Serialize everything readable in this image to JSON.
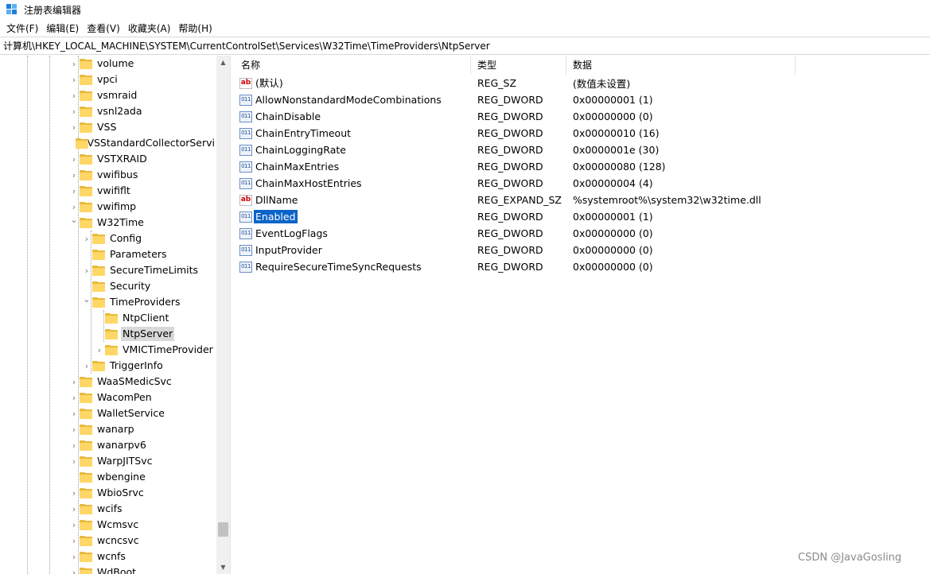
{
  "window": {
    "title": "注册表编辑器",
    "app_icon": "regedit-icon"
  },
  "menu": [
    "文件(F)",
    "编辑(E)",
    "查看(V)",
    "收藏夹(A)",
    "帮助(H)"
  ],
  "address": "计算机\\HKEY_LOCAL_MACHINE\\SYSTEM\\CurrentControlSet\\Services\\W32Time\\TimeProviders\\NtpServer",
  "tree": [
    {
      "label": "volume",
      "depth": 0,
      "expander": "collapsed"
    },
    {
      "label": "vpci",
      "depth": 0,
      "expander": "collapsed"
    },
    {
      "label": "vsmraid",
      "depth": 0,
      "expander": "collapsed"
    },
    {
      "label": "vsnl2ada",
      "depth": 0,
      "expander": "collapsed"
    },
    {
      "label": "VSS",
      "depth": 0,
      "expander": "collapsed"
    },
    {
      "label": "VSStandardCollectorServi",
      "depth": 0,
      "expander": "none"
    },
    {
      "label": "VSTXRAID",
      "depth": 0,
      "expander": "collapsed"
    },
    {
      "label": "vwifibus",
      "depth": 0,
      "expander": "collapsed"
    },
    {
      "label": "vwififlt",
      "depth": 0,
      "expander": "collapsed"
    },
    {
      "label": "vwifimp",
      "depth": 0,
      "expander": "collapsed"
    },
    {
      "label": "W32Time",
      "depth": 0,
      "expander": "expanded"
    },
    {
      "label": "Config",
      "depth": 1,
      "expander": "collapsed"
    },
    {
      "label": "Parameters",
      "depth": 1,
      "expander": "none"
    },
    {
      "label": "SecureTimeLimits",
      "depth": 1,
      "expander": "collapsed"
    },
    {
      "label": "Security",
      "depth": 1,
      "expander": "none"
    },
    {
      "label": "TimeProviders",
      "depth": 1,
      "expander": "expanded"
    },
    {
      "label": "NtpClient",
      "depth": 2,
      "expander": "none"
    },
    {
      "label": "NtpServer",
      "depth": 2,
      "expander": "none",
      "selected": true
    },
    {
      "label": "VMICTimeProvider",
      "depth": 2,
      "expander": "collapsed"
    },
    {
      "label": "TriggerInfo",
      "depth": 1,
      "expander": "collapsed"
    },
    {
      "label": "WaaSMedicSvc",
      "depth": 0,
      "expander": "collapsed"
    },
    {
      "label": "WacomPen",
      "depth": 0,
      "expander": "collapsed"
    },
    {
      "label": "WalletService",
      "depth": 0,
      "expander": "collapsed"
    },
    {
      "label": "wanarp",
      "depth": 0,
      "expander": "collapsed"
    },
    {
      "label": "wanarpv6",
      "depth": 0,
      "expander": "collapsed"
    },
    {
      "label": "WarpJITSvc",
      "depth": 0,
      "expander": "collapsed"
    },
    {
      "label": "wbengine",
      "depth": 0,
      "expander": "none"
    },
    {
      "label": "WbioSrvc",
      "depth": 0,
      "expander": "collapsed"
    },
    {
      "label": "wcifs",
      "depth": 0,
      "expander": "collapsed"
    },
    {
      "label": "Wcmsvc",
      "depth": 0,
      "expander": "collapsed"
    },
    {
      "label": "wcncsvc",
      "depth": 0,
      "expander": "collapsed"
    },
    {
      "label": "wcnfs",
      "depth": 0,
      "expander": "collapsed"
    },
    {
      "label": "WdBoot",
      "depth": 0,
      "expander": "collapsed"
    }
  ],
  "columns": {
    "name": "名称",
    "type": "类型",
    "data": "数据"
  },
  "values": [
    {
      "name": "(默认)",
      "type": "REG_SZ",
      "data": "(数值未设置)",
      "icon": "string-value-icon"
    },
    {
      "name": "AllowNonstandardModeCombinations",
      "type": "REG_DWORD",
      "data": "0x00000001 (1)",
      "icon": "binary-value-icon"
    },
    {
      "name": "ChainDisable",
      "type": "REG_DWORD",
      "data": "0x00000000 (0)",
      "icon": "binary-value-icon"
    },
    {
      "name": "ChainEntryTimeout",
      "type": "REG_DWORD",
      "data": "0x00000010 (16)",
      "icon": "binary-value-icon"
    },
    {
      "name": "ChainLoggingRate",
      "type": "REG_DWORD",
      "data": "0x0000001e (30)",
      "icon": "binary-value-icon"
    },
    {
      "name": "ChainMaxEntries",
      "type": "REG_DWORD",
      "data": "0x00000080 (128)",
      "icon": "binary-value-icon"
    },
    {
      "name": "ChainMaxHostEntries",
      "type": "REG_DWORD",
      "data": "0x00000004 (4)",
      "icon": "binary-value-icon"
    },
    {
      "name": "DllName",
      "type": "REG_EXPAND_SZ",
      "data": "%systemroot%\\system32\\w32time.dll",
      "icon": "string-value-icon"
    },
    {
      "name": "Enabled",
      "type": "REG_DWORD",
      "data": "0x00000001 (1)",
      "icon": "binary-value-icon",
      "selected": true
    },
    {
      "name": "EventLogFlags",
      "type": "REG_DWORD",
      "data": "0x00000000 (0)",
      "icon": "binary-value-icon"
    },
    {
      "name": "InputProvider",
      "type": "REG_DWORD",
      "data": "0x00000000 (0)",
      "icon": "binary-value-icon"
    },
    {
      "name": "RequireSecureTimeSyncRequests",
      "type": "REG_DWORD",
      "data": "0x00000000 (0)",
      "icon": "binary-value-icon"
    }
  ],
  "watermark": "CSDN @JavaGosling",
  "colors": {
    "selection": "#0a64c8",
    "folder": "#ffd766",
    "tree_selection": "#d9d9d9"
  }
}
